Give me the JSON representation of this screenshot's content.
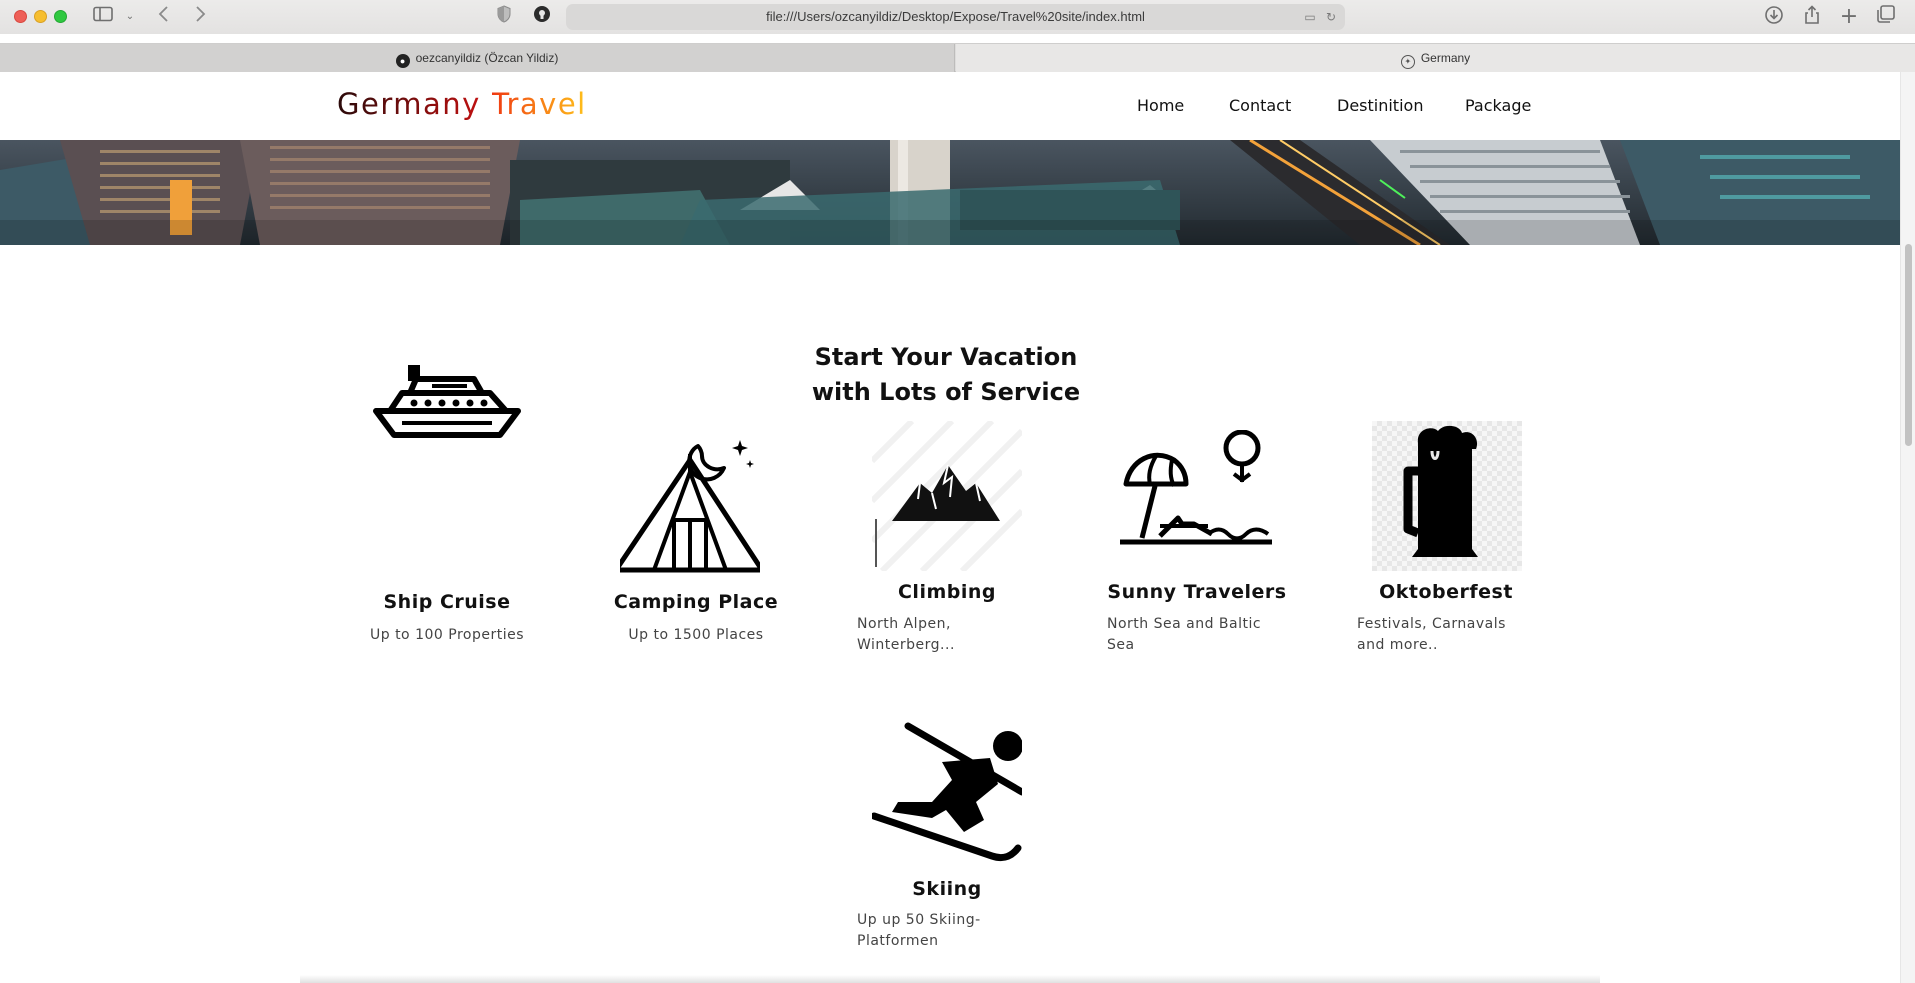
{
  "browser": {
    "url": "file:///Users/ozcanyildiz/Desktop/Expose/Travel%20site/index.html",
    "tabs": [
      {
        "label": "oezcanyildiz (Özcan Yildiz)"
      },
      {
        "label": "Germany"
      }
    ]
  },
  "site": {
    "logo_part1": "Germany",
    "logo_part2": "Travel",
    "nav": [
      "Home",
      "Contact",
      "Destinition",
      "Package"
    ]
  },
  "section": {
    "title_line1": "Start Your Vacation",
    "title_line2": "with Lots of Service"
  },
  "services": [
    {
      "title": "Ship Cruise",
      "subtitle": "Up to 100 Properties",
      "icon": "ship-icon"
    },
    {
      "title": "Camping Place",
      "subtitle": "Up to 1500 Places",
      "icon": "tent-icon"
    },
    {
      "title": "Climbing",
      "subtitle_l1": "North Alpen,",
      "subtitle_l2": "Winterberg...",
      "icon": "mountain-icon"
    },
    {
      "title": "Sunny Travelers",
      "subtitle_l1": "North Sea and Baltic",
      "subtitle_l2": "Sea",
      "icon": "beach-icon"
    },
    {
      "title": "Oktoberfest",
      "subtitle_l1": "Festivals, Carnavals",
      "subtitle_l2": "and more..",
      "icon": "beer-icon"
    },
    {
      "title": "Skiing",
      "subtitle_l1": "Up up 50 Skiing-",
      "subtitle_l2": "Platformen",
      "icon": "skier-icon"
    }
  ]
}
